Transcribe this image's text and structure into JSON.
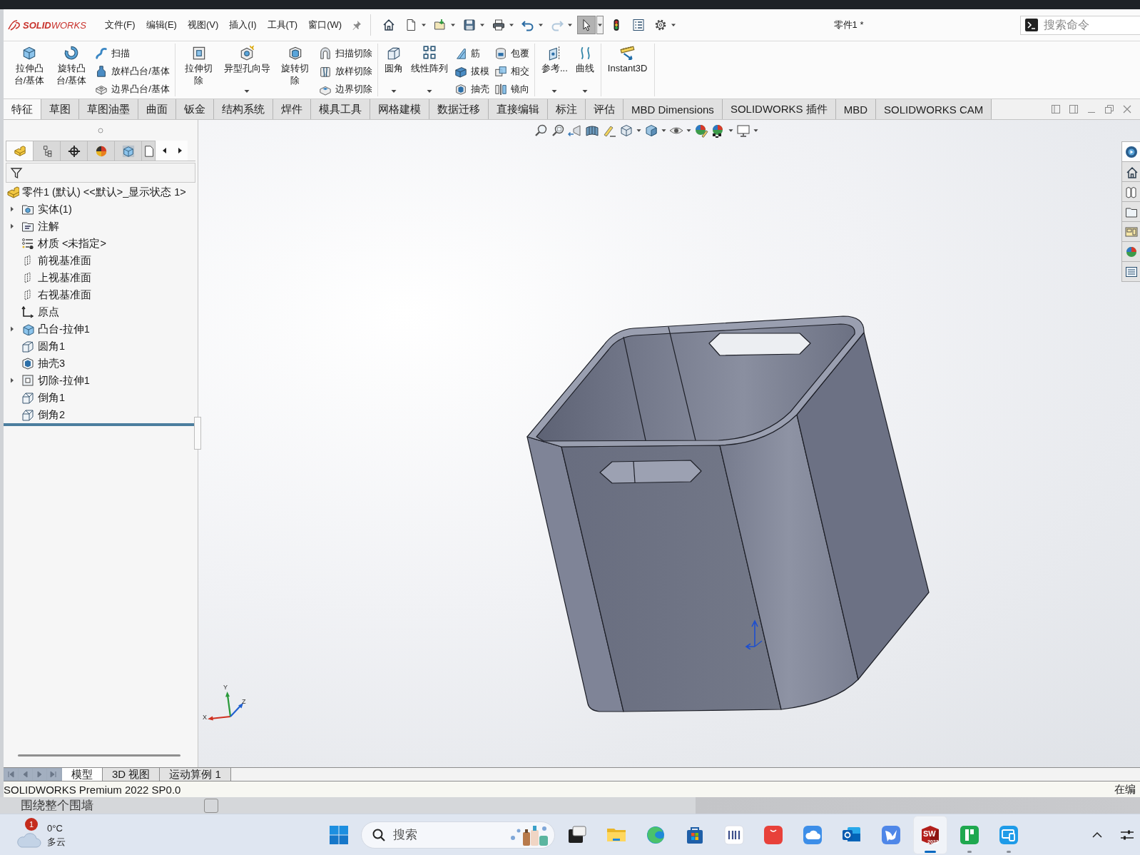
{
  "app": {
    "logo": "**SOLID**WORKS",
    "title": "零件1 *"
  },
  "menu": [
    "文件(F)",
    "编辑(E)",
    "视图(V)",
    "插入(I)",
    "工具(T)",
    "窗口(W)"
  ],
  "quick_access": [
    {
      "dropdown": false,
      "disabled": false,
      "selected": false
    },
    {
      "dropdown": true,
      "disabled": false,
      "selected": false
    },
    {
      "dropdown": true,
      "disabled": false,
      "selected": false
    },
    {
      "dropdown": true,
      "disabled": false,
      "selected": false
    },
    {
      "dropdown": true,
      "disabled": false,
      "selected": false
    },
    {
      "dropdown": true,
      "disabled": false,
      "selected": false
    },
    {
      "dropdown": true,
      "disabled": true,
      "selected": false
    },
    {
      "dropdown": true,
      "disabled": false,
      "selected": true
    },
    {
      "dropdown": false,
      "disabled": false,
      "selected": false
    },
    {
      "dropdown": false,
      "disabled": false,
      "selected": false
    },
    {
      "dropdown": true,
      "disabled": false,
      "selected": false
    }
  ],
  "search": {
    "placeholder": "搜索命令"
  },
  "ribbon": [
    {
      "items": [
        {
          "kind": "large",
          "label": "拉伸凸台/基体",
          "dropdown": false
        },
        {
          "kind": "large",
          "label": "旋转凸台/基体",
          "dropdown": false
        },
        {
          "kind": "stack",
          "items": [
            {
              "label": "扫描"
            },
            {
              "label": "放样凸台/基体"
            },
            {
              "label": "边界凸台/基体"
            }
          ]
        }
      ]
    },
    {
      "items": [
        {
          "kind": "large",
          "label": "拉伸切除",
          "dropdown": false
        },
        {
          "kind": "large",
          "label": "异型孔向导",
          "dropdown": true
        },
        {
          "kind": "large",
          "label": "旋转切除",
          "dropdown": false
        },
        {
          "kind": "stack",
          "items": [
            {
              "label": "扫描切除"
            },
            {
              "label": "放样切除"
            },
            {
              "label": "边界切除"
            }
          ]
        }
      ]
    },
    {
      "items": [
        {
          "kind": "large",
          "label": "圆角",
          "dropdown": true
        },
        {
          "kind": "large",
          "label": "线性阵列",
          "dropdown": true
        },
        {
          "kind": "stack",
          "items": [
            {
              "label": "筋"
            },
            {
              "label": "拔模"
            },
            {
              "label": "抽壳"
            }
          ]
        },
        {
          "kind": "stack",
          "items": [
            {
              "label": "包覆"
            },
            {
              "label": "相交"
            },
            {
              "label": "镜向"
            }
          ]
        }
      ]
    },
    {
      "items": [
        {
          "kind": "large",
          "label": "参考...",
          "dropdown": true
        },
        {
          "kind": "large",
          "label": "曲线",
          "dropdown": true
        }
      ]
    },
    {
      "items": [
        {
          "kind": "large",
          "label": "Instant3D",
          "dropdown": false
        }
      ]
    }
  ],
  "tabs": [
    {
      "label": "特征",
      "selected": true
    },
    {
      "label": "草图",
      "selected": false
    },
    {
      "label": "草图油墨",
      "selected": false
    },
    {
      "label": "曲面",
      "selected": false
    },
    {
      "label": "钣金",
      "selected": false
    },
    {
      "label": "结构系统",
      "selected": false
    },
    {
      "label": "焊件",
      "selected": false
    },
    {
      "label": "模具工具",
      "selected": false
    },
    {
      "label": "网格建模",
      "selected": false
    },
    {
      "label": "数据迁移",
      "selected": false
    },
    {
      "label": "直接编辑",
      "selected": false
    },
    {
      "label": "标注",
      "selected": false
    },
    {
      "label": "评估",
      "selected": false
    },
    {
      "label": "MBD Dimensions",
      "selected": false
    },
    {
      "label": "SOLIDWORKS 插件",
      "selected": false
    },
    {
      "label": "MBD",
      "selected": false
    },
    {
      "label": "SOLIDWORKS CAM",
      "selected": false
    }
  ],
  "feature_manager": {
    "tabs": [
      {
        "selected": true
      },
      {
        "selected": false
      },
      {
        "selected": false
      },
      {
        "selected": false
      },
      {
        "selected": false
      },
      {
        "selected": false
      }
    ],
    "tree": {
      "label": "零件1 (默认) <<默认>_显示状态 1>",
      "kind": "part",
      "children": [
        {
          "label": "实体(1)",
          "kind": "bodies",
          "collapsed": true
        },
        {
          "label": "注解",
          "kind": "annotations",
          "collapsed": true
        },
        {
          "label": "材质 <未指定>",
          "kind": "material",
          "collapsed": false
        },
        {
          "label": "前视基准面",
          "kind": "plane",
          "collapsed": false
        },
        {
          "label": "上视基准面",
          "kind": "plane",
          "collapsed": false
        },
        {
          "label": "右视基准面",
          "kind": "plane",
          "collapsed": false
        },
        {
          "label": "原点",
          "kind": "origin",
          "collapsed": false
        },
        {
          "label": "凸台-拉伸1",
          "kind": "boss",
          "collapsed": true
        },
        {
          "label": "圆角1",
          "kind": "fillet",
          "collapsed": false
        },
        {
          "label": "抽壳3",
          "kind": "shell",
          "collapsed": false
        },
        {
          "label": "切除-拉伸1",
          "kind": "cut",
          "collapsed": true
        },
        {
          "label": "倒角1",
          "kind": "chamfer",
          "collapsed": false
        },
        {
          "label": "倒角2",
          "kind": "chamfer",
          "collapsed": false
        }
      ]
    }
  },
  "view_toolbar": [
    {
      "dropdown": false
    },
    {
      "dropdown": false
    },
    {
      "dropdown": false
    },
    {
      "dropdown": false
    },
    {
      "dropdown": false
    },
    {
      "dropdown": true
    },
    {
      "dropdown": true
    },
    {
      "dropdown": true
    },
    {
      "dropdown": false
    },
    {
      "dropdown": true
    },
    {
      "dropdown": true
    }
  ],
  "task_pane": [
    {
      "selected": true
    },
    {
      "selected": false
    },
    {
      "selected": false
    },
    {
      "selected": false
    },
    {
      "selected": false
    },
    {
      "selected": false
    },
    {
      "selected": false
    }
  ],
  "triad": [
    "X",
    "Y",
    "Z"
  ],
  "sheet_tabs": [
    {
      "label": "模型",
      "selected": true
    },
    {
      "label": "3D 视图",
      "selected": false
    },
    {
      "label": "运动算例 1",
      "selected": false
    }
  ],
  "status_bar": {
    "text": "SOLIDWORKS Premium 2022 SP0.0",
    "right": "在编"
  },
  "background_window": {
    "label": "围绕整个围墙",
    "checked": false
  },
  "taskbar": {
    "weather": {
      "badge": "1",
      "temperature": "0°C",
      "condition": "多云"
    },
    "search": {
      "placeholder": "搜索"
    },
    "apps": [
      {
        "selected": false,
        "running": false
      },
      {
        "selected": false,
        "running": false
      },
      {
        "selected": false,
        "running": false
      },
      {
        "selected": false,
        "running": false
      },
      {
        "selected": false,
        "running": false
      },
      {
        "selected": false,
        "running": false
      },
      {
        "selected": false,
        "running": false
      },
      {
        "selected": false,
        "running": false
      },
      {
        "selected": false,
        "running": false
      },
      {
        "selected": true,
        "running": true,
        "text": "SW",
        "subtext": "2022"
      },
      {
        "selected": false,
        "running": true
      },
      {
        "selected": false,
        "running": true
      }
    ]
  }
}
